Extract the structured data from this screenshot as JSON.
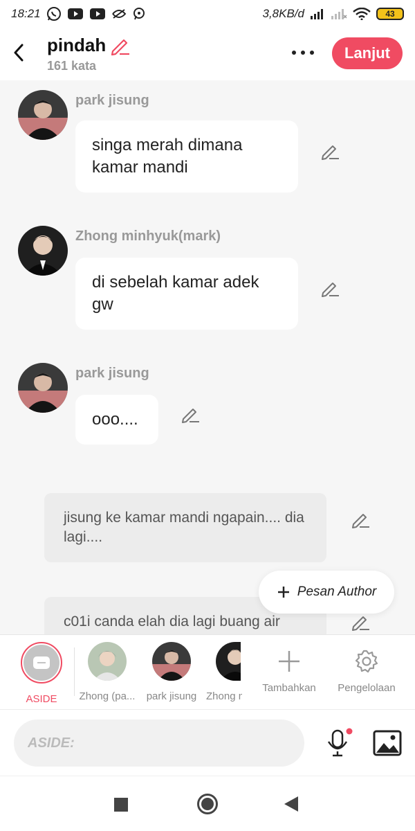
{
  "status": {
    "time": "18:21",
    "network_speed": "3,8KB/d",
    "battery": "43"
  },
  "header": {
    "title": "pindah",
    "word_count": "161 kata",
    "next_label": "Lanjut"
  },
  "messages": [
    {
      "sender": "park jisung",
      "text": "singa merah dimana kamar mandi"
    },
    {
      "sender": "Zhong minhyuk(mark)",
      "text": "di sebelah kamar adek gw"
    },
    {
      "sender": "park jisung",
      "text": "ooo...."
    }
  ],
  "narrations": [
    {
      "text": "jisung ke kamar mandi ngapain.... dia lagi...."
    },
    {
      "text": "c01i canda elah dia lagi buang air"
    }
  ],
  "float_button": {
    "label": "Pesan Author"
  },
  "characters": {
    "aside": "ASIDE",
    "items": [
      {
        "label": "Zhong (pa..."
      },
      {
        "label": "park jisung"
      },
      {
        "label": "Zhong m"
      }
    ],
    "add_label": "Tambahkan",
    "manage_label": "Pengelolaan"
  },
  "input": {
    "placeholder": "ASIDE:"
  },
  "colors": {
    "accent": "#f04b62",
    "background": "#f6f6f6",
    "bubble": "#ffffff",
    "narration": "#ececec"
  }
}
